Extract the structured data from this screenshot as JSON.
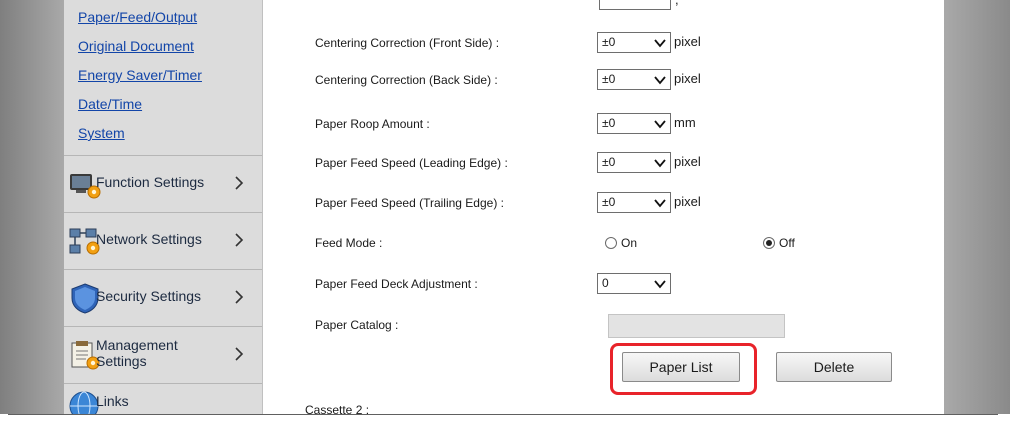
{
  "sidebar": {
    "sub_links": [
      "Paper/Feed/Output",
      "Original Document",
      "Energy Saver/Timer",
      "Date/Time",
      "System"
    ],
    "nav_items": [
      {
        "label": "Function Settings",
        "icon": "function-settings-icon"
      },
      {
        "label": "Network Settings",
        "icon": "network-settings-icon"
      },
      {
        "label": "Security Settings",
        "icon": "security-settings-icon"
      },
      {
        "label_line1": "Management",
        "label_line2": "Settings",
        "icon": "management-settings-icon"
      },
      {
        "label": "Links",
        "icon": "links-icon"
      }
    ]
  },
  "settings": {
    "rows": [
      {
        "label": "Centering Correction (Front Side) :",
        "value": "±0",
        "unit": "pixel"
      },
      {
        "label": "Centering Correction (Back Side) :",
        "value": "±0",
        "unit": "pixel"
      },
      {
        "label": "Paper Roop Amount :",
        "value": "±0",
        "unit": "mm"
      },
      {
        "label": "Paper Feed Speed (Leading Edge) :",
        "value": "±0",
        "unit": "pixel"
      },
      {
        "label": "Paper Feed Speed (Trailing Edge) :",
        "value": "±0",
        "unit": "pixel"
      }
    ],
    "top_unit": ",",
    "feed_mode": {
      "label": "Feed Mode :",
      "option_on": "On",
      "option_off": "Off",
      "selected": "Off"
    },
    "deck_adjustment": {
      "label": "Paper Feed Deck Adjustment :",
      "value": "0"
    },
    "paper_catalog": {
      "label": "Paper Catalog :",
      "value": ""
    },
    "buttons": {
      "paper_list": "Paper List",
      "delete": "Delete"
    },
    "next_section": "Cassette 2 :"
  },
  "colors": {
    "link": "#1245a8",
    "highlight": "#e8232a",
    "sidebar_bg": "#dcdcdc"
  }
}
